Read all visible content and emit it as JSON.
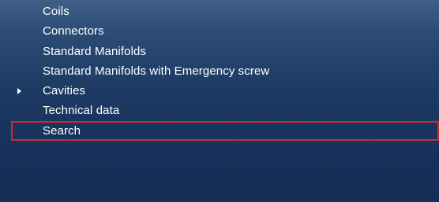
{
  "menu": {
    "items": [
      {
        "label": "Coils",
        "has_arrow": false,
        "selected": false
      },
      {
        "label": "Connectors",
        "has_arrow": false,
        "selected": false
      },
      {
        "label": "Standard Manifolds",
        "has_arrow": false,
        "selected": false
      },
      {
        "label": "Standard Manifolds with Emergency screw",
        "has_arrow": false,
        "selected": false
      },
      {
        "label": "Cavities",
        "has_arrow": true,
        "selected": false
      },
      {
        "label": "Technical data",
        "has_arrow": false,
        "selected": false
      },
      {
        "label": "Search",
        "has_arrow": false,
        "selected": true
      }
    ]
  },
  "colors": {
    "panel_top": "#3f5f88",
    "panel_bottom": "#142e55",
    "text": "#ffffff",
    "selection_outline": "#d6262e"
  },
  "icons": {
    "expand_arrow": "caret-right-icon"
  }
}
